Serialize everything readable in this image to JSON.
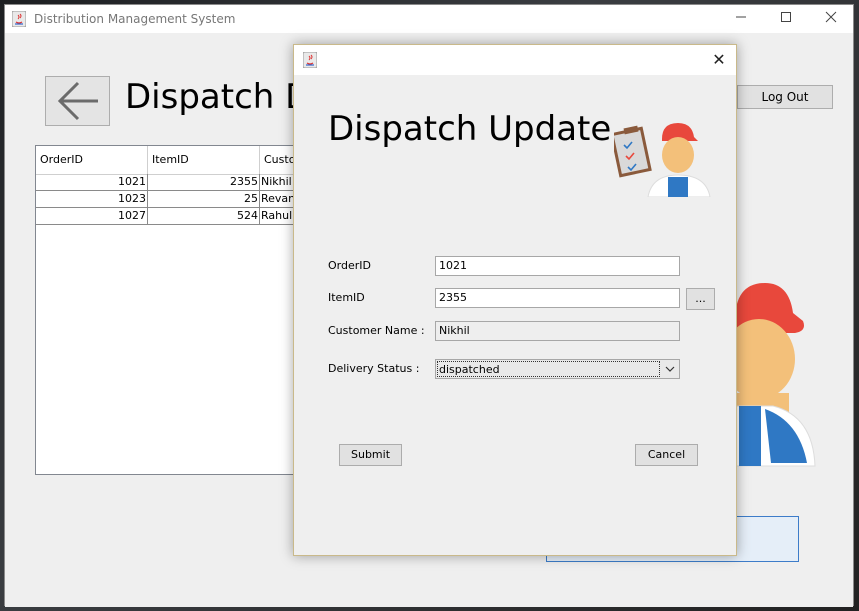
{
  "main_window": {
    "title": "Distribution Management System",
    "minimize_icon": "minimize-icon",
    "maximize_icon": "maximize-icon",
    "close_icon": "close-icon",
    "page_title": "Dispatch D",
    "logout_label": "Log Out",
    "back_icon": "arrow-left-icon"
  },
  "orders_table": {
    "columns": [
      "OrderID",
      "ItemID",
      "Custo"
    ],
    "rows": [
      {
        "order_id": "1021",
        "item_id": "2355",
        "customer": "Nikhil"
      },
      {
        "order_id": "1023",
        "item_id": "25",
        "customer": "Revann"
      },
      {
        "order_id": "1027",
        "item_id": "524",
        "customer": "Rahul"
      }
    ]
  },
  "dialog": {
    "heading": "Dispatch Update",
    "close_label": "✕",
    "order_id_label": "OrderID",
    "order_id_value": "1021",
    "item_id_label": "ItemID",
    "item_id_value": "2355",
    "browse_label": "...",
    "customer_name_label": "Customer Name :",
    "customer_name_value": "Nikhil",
    "delivery_status_label": "Delivery Status :",
    "delivery_status_value": "dispatched",
    "submit_label": "Submit",
    "cancel_label": "Cancel"
  },
  "colors": {
    "accent_blue": "#3d7cc9",
    "worker_cap": "#e8483c",
    "worker_overalls": "#2f78c4"
  }
}
